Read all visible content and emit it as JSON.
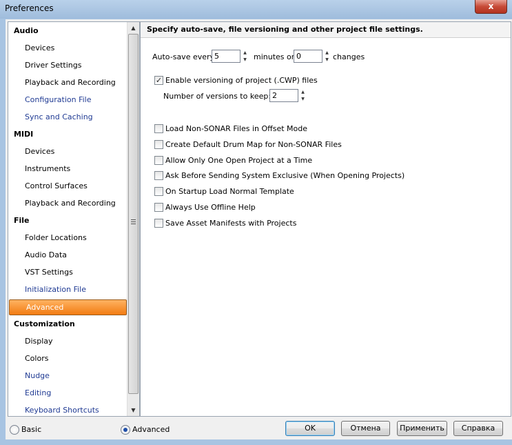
{
  "window": {
    "title": "Preferences",
    "close_label": "x"
  },
  "tree": {
    "items": [
      {
        "label": "Audio",
        "type": "cat"
      },
      {
        "label": "Devices",
        "type": "sub"
      },
      {
        "label": "Driver Settings",
        "type": "sub"
      },
      {
        "label": "Playback and Recording",
        "type": "sub"
      },
      {
        "label": "Configuration File",
        "type": "sub link"
      },
      {
        "label": "Sync and Caching",
        "type": "sub link"
      },
      {
        "label": "MIDI",
        "type": "cat"
      },
      {
        "label": "Devices",
        "type": "sub"
      },
      {
        "label": "Instruments",
        "type": "sub"
      },
      {
        "label": "Control Surfaces",
        "type": "sub"
      },
      {
        "label": "Playback and Recording",
        "type": "sub"
      },
      {
        "label": "File",
        "type": "cat"
      },
      {
        "label": "Folder Locations",
        "type": "sub"
      },
      {
        "label": "Audio Data",
        "type": "sub"
      },
      {
        "label": "VST Settings",
        "type": "sub"
      },
      {
        "label": "Initialization File",
        "type": "sub link"
      },
      {
        "label": "Advanced",
        "type": "sub selected"
      },
      {
        "label": "Customization",
        "type": "cat"
      },
      {
        "label": "Display",
        "type": "sub"
      },
      {
        "label": "Colors",
        "type": "sub"
      },
      {
        "label": "Nudge",
        "type": "sub link"
      },
      {
        "label": "Editing",
        "type": "sub link"
      },
      {
        "label": "Keyboard Shortcuts",
        "type": "sub link"
      }
    ]
  },
  "panel": {
    "header": "Specify auto-save, file versioning and other project file settings.",
    "autosave_label": "Auto-save every",
    "autosave_minutes": "5",
    "minutes_or_label": "minutes or",
    "autosave_changes": "0",
    "changes_label": "changes",
    "versioning_label": "Enable versioning of project (.CWP) files",
    "versions_keep_label": "Number of versions to keep:",
    "versions_keep_value": "2",
    "options": [
      {
        "label": "Load Non-SONAR Files in Offset Mode",
        "checked": false
      },
      {
        "label": "Create Default Drum Map for Non-SONAR Files",
        "checked": false
      },
      {
        "label": "Allow Only One Open Project at a Time",
        "checked": false
      },
      {
        "label": "Ask Before Sending System Exclusive (When Opening Projects)",
        "checked": false
      },
      {
        "label": "On Startup Load Normal Template",
        "checked": false
      },
      {
        "label": "Always Use Offline Help",
        "checked": false
      },
      {
        "label": "Save Asset Manifests with Projects",
        "checked": false
      }
    ]
  },
  "bottom": {
    "basic_label": "Basic",
    "advanced_label": "Advanced",
    "ok_label": "OK",
    "cancel_label": "Отмена",
    "apply_label": "Применить",
    "help_label": "Справка"
  },
  "colors": {
    "selected_item": "#f27b12",
    "link_text": "#1f3a93"
  }
}
